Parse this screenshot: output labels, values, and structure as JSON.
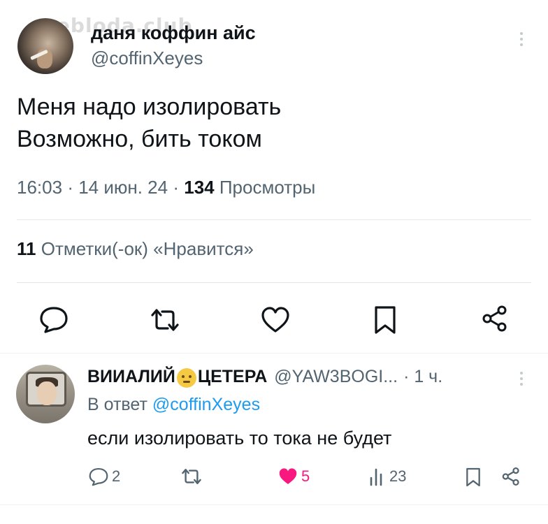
{
  "watermark": "nebloda.club",
  "tweet": {
    "author_name": "даня коффин айс",
    "author_handle": "@coffinXeyes",
    "lines": [
      "Меня надо изолировать",
      "Возможно, бить током"
    ],
    "time": "16:03",
    "date": "14 июн. 24",
    "views_count": "134",
    "views_label": "Просмотры",
    "likes_count": "11",
    "likes_label": "Отметки(-ок) «Нравится»"
  },
  "actions": {
    "icons": [
      "reply-icon",
      "retweet-icon",
      "like-icon",
      "bookmark-icon",
      "share-icon"
    ]
  },
  "reply": {
    "author_name_part1": "ВИИАЛИЙ",
    "author_name_part2": "ЦЕТЕРА",
    "emoji": "smiling-face-emoji",
    "author_handle": "@YAW3BOGI...",
    "time": "· 1 ч.",
    "reply_prefix": "В ответ",
    "reply_to": "@coffinXeyes",
    "text": "если изолировать то тока не будет",
    "reply_count": "2",
    "like_count": "5",
    "views_count": "23"
  },
  "colors": {
    "text": "#0f1419",
    "secondary": "#536471",
    "link": "#1d9bf0",
    "like": "#f91880",
    "divider": "#e6e9ec"
  }
}
